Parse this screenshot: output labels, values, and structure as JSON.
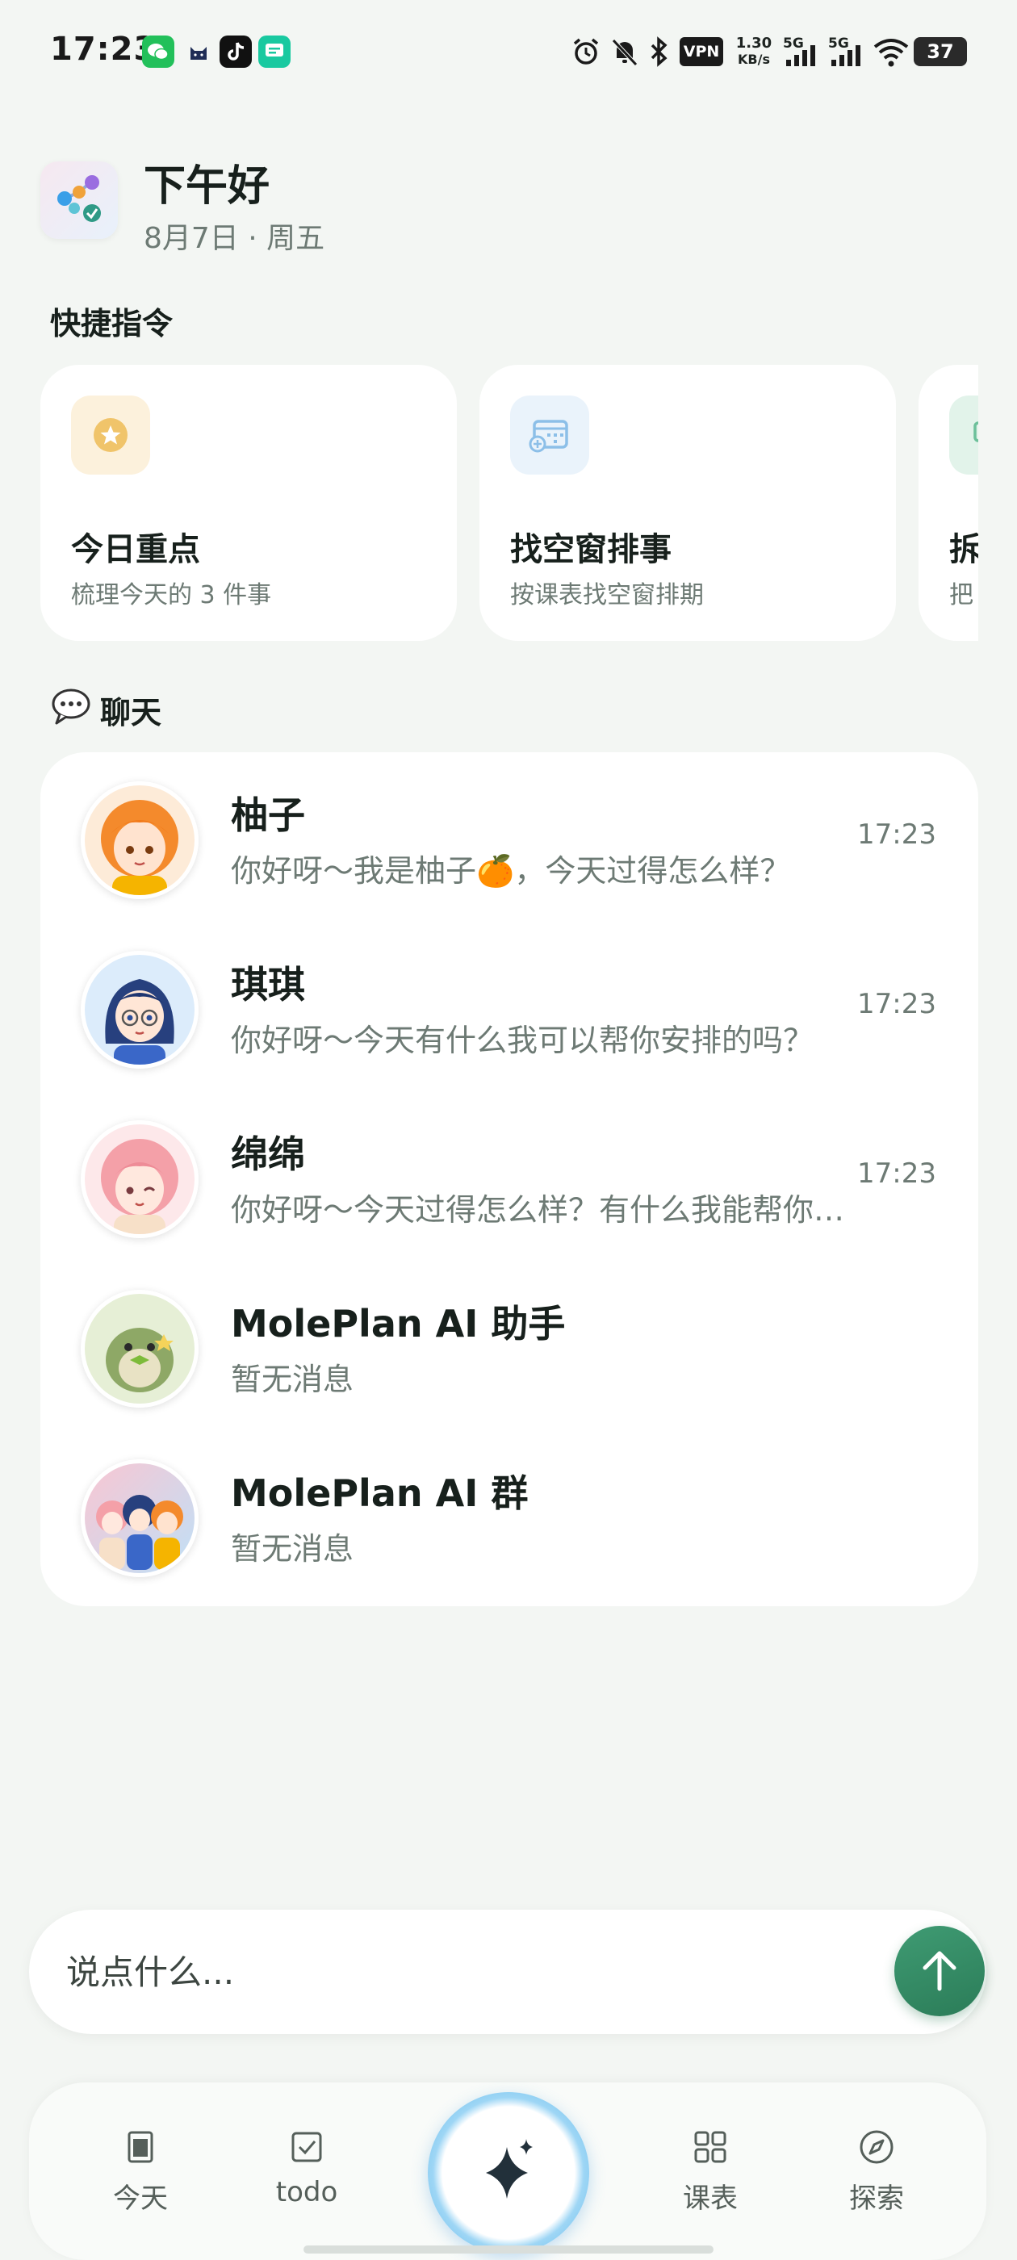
{
  "status_bar": {
    "time": "17:23",
    "vpn": "VPN",
    "speed": [
      "1.30",
      "KB/s"
    ],
    "network": [
      "5G",
      "5G"
    ],
    "battery": "37"
  },
  "header": {
    "greeting": "下午好",
    "date": "8月7日 · 周五"
  },
  "quick_commands": {
    "title": "快捷指令",
    "cards": [
      {
        "title": "今日重点",
        "subtitle": "梳理今天的 3 件事",
        "icon": "star-icon"
      },
      {
        "title": "找空窗排事",
        "subtitle": "按课表找空窗排期",
        "icon": "calendar-add-icon"
      },
      {
        "title": "拆",
        "subtitle": "把",
        "icon": "list-icon"
      }
    ]
  },
  "chat": {
    "title": "聊天",
    "icon": "speech-bubble-icon",
    "items": [
      {
        "name": "柚子",
        "message": "你好呀～我是柚子🍊，今天过得怎么样？",
        "time": "17:23"
      },
      {
        "name": "琪琪",
        "message": "你好呀～今天有什么我可以帮你安排的吗？",
        "time": "17:23"
      },
      {
        "name": "绵绵",
        "message": "你好呀～今天过得怎么样？有什么我能帮你的？",
        "time": "17:23"
      },
      {
        "name": "MolePlan AI 助手",
        "message": "暂无消息",
        "time": ""
      },
      {
        "name": "MolePlan AI 群",
        "message": "暂无消息",
        "time": ""
      }
    ]
  },
  "input": {
    "placeholder": "说点什么..."
  },
  "tabs": [
    {
      "label": "今天",
      "icon": "document-icon"
    },
    {
      "label": "todo",
      "icon": "checkbox-icon"
    },
    {
      "label": "",
      "icon": "sparkle-icon"
    },
    {
      "label": "课表",
      "icon": "grid-icon"
    },
    {
      "label": "探索",
      "icon": "compass-icon"
    }
  ],
  "colors": {
    "background": "#f3f6f3",
    "accent_green": "#2f8a62",
    "accent_blue": "#58b6ee"
  }
}
